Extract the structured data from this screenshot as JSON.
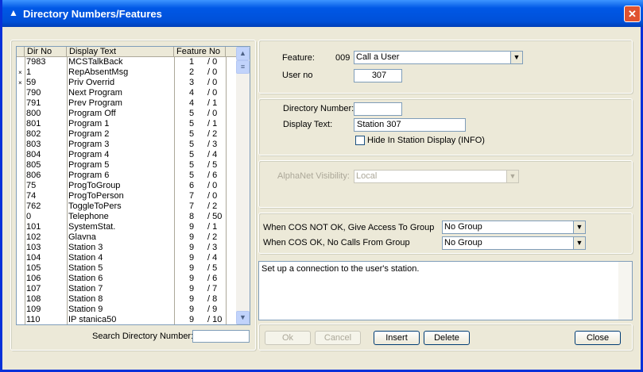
{
  "window": {
    "title": "Directory Numbers/Features",
    "close": "✕"
  },
  "list": {
    "headers": [
      "Dir No",
      "Display Text",
      "Feature No"
    ],
    "rows": [
      {
        "mark": "",
        "dir": "7983",
        "text": "MCSTalkBack",
        "feat": "1",
        "sub": "/ 0"
      },
      {
        "mark": "×",
        "dir": "1",
        "text": "RepAbsentMsg",
        "feat": "2",
        "sub": "/ 0"
      },
      {
        "mark": "×",
        "dir": "59",
        "text": "Priv Overrid",
        "feat": "3",
        "sub": "/ 0"
      },
      {
        "mark": "",
        "dir": "790",
        "text": "Next Program",
        "feat": "4",
        "sub": "/ 0"
      },
      {
        "mark": "",
        "dir": "791",
        "text": "Prev Program",
        "feat": "4",
        "sub": "/ 1"
      },
      {
        "mark": "",
        "dir": "800",
        "text": "Program Off",
        "feat": "5",
        "sub": "/ 0"
      },
      {
        "mark": "",
        "dir": "801",
        "text": "Program 1",
        "feat": "5",
        "sub": "/ 1"
      },
      {
        "mark": "",
        "dir": "802",
        "text": "Program 2",
        "feat": "5",
        "sub": "/ 2"
      },
      {
        "mark": "",
        "dir": "803",
        "text": "Program 3",
        "feat": "5",
        "sub": "/ 3"
      },
      {
        "mark": "",
        "dir": "804",
        "text": "Program 4",
        "feat": "5",
        "sub": "/ 4"
      },
      {
        "mark": "",
        "dir": "805",
        "text": "Program 5",
        "feat": "5",
        "sub": "/ 5"
      },
      {
        "mark": "",
        "dir": "806",
        "text": "Program 6",
        "feat": "5",
        "sub": "/ 6"
      },
      {
        "mark": "",
        "dir": "75",
        "text": "ProgToGroup",
        "feat": "6",
        "sub": "/ 0"
      },
      {
        "mark": "",
        "dir": "74",
        "text": "ProgToPerson",
        "feat": "7",
        "sub": "/ 0"
      },
      {
        "mark": "",
        "dir": "762",
        "text": "ToggleToPers",
        "feat": "7",
        "sub": "/ 2"
      },
      {
        "mark": "",
        "dir": "0",
        "text": "Telephone",
        "feat": "8",
        "sub": "/ 50"
      },
      {
        "mark": "",
        "dir": "101",
        "text": "SystemStat.",
        "feat": "9",
        "sub": "/ 1"
      },
      {
        "mark": "",
        "dir": "102",
        "text": "Glavna",
        "feat": "9",
        "sub": "/ 2"
      },
      {
        "mark": "",
        "dir": "103",
        "text": "Station 3",
        "feat": "9",
        "sub": "/ 3"
      },
      {
        "mark": "",
        "dir": "104",
        "text": "Station 4",
        "feat": "9",
        "sub": "/ 4"
      },
      {
        "mark": "",
        "dir": "105",
        "text": "Station 5",
        "feat": "9",
        "sub": "/ 5"
      },
      {
        "mark": "",
        "dir": "106",
        "text": "Station 6",
        "feat": "9",
        "sub": "/ 6"
      },
      {
        "mark": "",
        "dir": "107",
        "text": "Station 7",
        "feat": "9",
        "sub": "/ 7"
      },
      {
        "mark": "",
        "dir": "108",
        "text": "Station 8",
        "feat": "9",
        "sub": "/ 8"
      },
      {
        "mark": "",
        "dir": "109",
        "text": "Station 9",
        "feat": "9",
        "sub": "/ 9"
      },
      {
        "mark": "",
        "dir": "110",
        "text": "IP stanica50",
        "feat": "9",
        "sub": "/ 10"
      }
    ],
    "search_label": "Search Directory Number:",
    "search_value": ""
  },
  "feature": {
    "label": "Feature:",
    "code": "009",
    "value": "Call a User",
    "user_label": "User no",
    "user_value": "307"
  },
  "directory": {
    "dn_label": "Directory Number:",
    "dn_value": "",
    "dt_label": "Display Text:",
    "dt_value": "Station 307",
    "hide_label": "Hide In Station Display (INFO)"
  },
  "alphanet": {
    "label": "AlphaNet Visibility:",
    "value": "Local"
  },
  "cos": {
    "not_ok_label": "When COS NOT OK, Give Access To Group",
    "not_ok_value": "No Group",
    "ok_label": "When COS OK, No Calls From Group",
    "ok_value": "No Group"
  },
  "description": "Set up a connection to the user's station.",
  "buttons": {
    "ok": "Ok",
    "cancel": "Cancel",
    "insert": "Insert",
    "delete": "Delete",
    "close": "Close"
  }
}
